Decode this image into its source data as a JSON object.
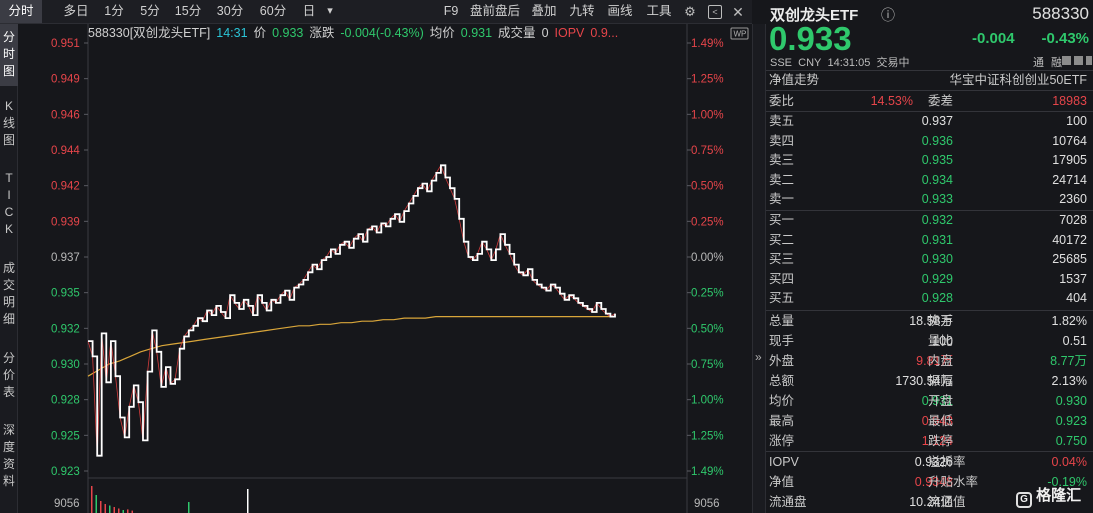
{
  "toolbar": {
    "tabs": [
      "分时",
      "多日",
      "1分",
      "5分",
      "15分",
      "30分",
      "60分",
      "日"
    ],
    "dropdown_glyph": "▾",
    "right_items": [
      "F9",
      "盘前盘后",
      "叠加",
      "九转",
      "画线",
      "工具"
    ]
  },
  "vtabs": [
    {
      "chars": [
        "分",
        "时",
        "图"
      ]
    },
    {
      "chars": [
        "K",
        "线",
        "图"
      ]
    },
    {
      "chars": [
        "T",
        "I",
        "C",
        "K"
      ]
    },
    {
      "chars": [
        "成",
        "交",
        "明",
        "细"
      ]
    },
    {
      "chars": [
        "分",
        "价",
        "表"
      ]
    },
    {
      "chars": [
        "深",
        "度",
        "资",
        "料"
      ]
    }
  ],
  "info_line": {
    "code_name": "588330[双创龙头ETF]",
    "time": "14:31",
    "price_label": "价",
    "price": "0.933",
    "change_label": "涨跌",
    "change": "-0.004(-0.43%)",
    "avg_label": "均价",
    "avg": "0.931",
    "vol_label": "成交量",
    "vol": "0",
    "iopv_label": "IOPV",
    "iopv": "0.9..."
  },
  "chart_data": {
    "type": "line",
    "left_axis": [
      {
        "label": "0.951",
        "color": "red"
      },
      {
        "label": "0.949",
        "color": "red"
      },
      {
        "label": "0.946",
        "color": "red"
      },
      {
        "label": "0.944",
        "color": "red"
      },
      {
        "label": "0.942",
        "color": "red"
      },
      {
        "label": "0.939",
        "color": "red"
      },
      {
        "label": "0.937",
        "color": "gray"
      },
      {
        "label": "0.935",
        "color": "green"
      },
      {
        "label": "0.932",
        "color": "green"
      },
      {
        "label": "0.930",
        "color": "green"
      },
      {
        "label": "0.928",
        "color": "green"
      },
      {
        "label": "0.925",
        "color": "green"
      },
      {
        "label": "0.923",
        "color": "green"
      }
    ],
    "right_axis": [
      {
        "label": "1.49%",
        "color": "red"
      },
      {
        "label": "1.25%",
        "color": "red"
      },
      {
        "label": "1.00%",
        "color": "red"
      },
      {
        "label": "0.75%",
        "color": "red"
      },
      {
        "label": "0.50%",
        "color": "red"
      },
      {
        "label": "0.25%",
        "color": "red"
      },
      {
        "label": "0.00%",
        "color": "gray"
      },
      {
        "label": "0.25%",
        "color": "green"
      },
      {
        "label": "0.50%",
        "color": "green"
      },
      {
        "label": "0.75%",
        "color": "green"
      },
      {
        "label": "1.00%",
        "color": "green"
      },
      {
        "label": "1.25%",
        "color": "green"
      },
      {
        "label": "1.49%",
        "color": "green"
      }
    ],
    "ylim": [
      0.923,
      0.951
    ],
    "volume_axis_label": "9056",
    "price_series": [
      0.9315,
      0.9305,
      0.924,
      0.932,
      0.9288,
      0.9315,
      0.9292,
      0.9265,
      0.9252,
      0.9272,
      0.9286,
      0.9275,
      0.925,
      0.9295,
      0.9322,
      0.9308,
      0.9285,
      0.9298,
      0.9287,
      0.929,
      0.931,
      0.9318,
      0.9322,
      0.9325,
      0.933,
      0.9328,
      0.9335,
      0.9332,
      0.9338,
      0.9334,
      0.933,
      0.9345,
      0.934,
      0.9336,
      0.9342,
      0.9338,
      0.9332,
      0.9345,
      0.934,
      0.9335,
      0.9342,
      0.934,
      0.9345,
      0.9348,
      0.9342,
      0.935,
      0.9352,
      0.9355,
      0.936,
      0.9365,
      0.9362,
      0.9368,
      0.937,
      0.9375,
      0.9372,
      0.9378,
      0.938,
      0.9376,
      0.9382,
      0.9385,
      0.938,
      0.9388,
      0.939,
      0.9386,
      0.9392,
      0.939,
      0.9395,
      0.9398,
      0.9393,
      0.94,
      0.9405,
      0.941,
      0.9415,
      0.9418,
      0.9413,
      0.942,
      0.9425,
      0.943,
      0.9422,
      0.9415,
      0.9408,
      0.9395,
      0.938,
      0.937,
      0.9368,
      0.9372,
      0.938,
      0.9375,
      0.9368,
      0.9375,
      0.9385,
      0.9378,
      0.9372,
      0.9365,
      0.936,
      0.9358,
      0.9362,
      0.9355,
      0.9352,
      0.935,
      0.9348,
      0.9352,
      0.935,
      0.9346,
      0.9342,
      0.9345,
      0.9343,
      0.934,
      0.9338,
      0.9336,
      0.9334,
      0.934,
      0.9336,
      0.9333,
      0.9331,
      0.9333
    ],
    "avg_series": [
      0.9292,
      0.9296,
      0.93,
      0.9302,
      0.9305,
      0.9308,
      0.931,
      0.9312,
      0.9313,
      0.9314,
      0.9315,
      0.9316,
      0.9317,
      0.9318,
      0.9319,
      0.932,
      0.9321,
      0.9322,
      0.9323,
      0.9324,
      0.9325,
      0.9325,
      0.9326,
      0.9326,
      0.9327,
      0.9327,
      0.9328,
      0.9328,
      0.9329,
      0.9329,
      0.933,
      0.933,
      0.933,
      0.9331,
      0.9331,
      0.9331,
      0.9331,
      0.9331,
      0.9331,
      0.9331,
      0.9331,
      0.9331,
      0.9331,
      0.9331,
      0.9331,
      0.9331,
      0.9331,
      0.9331,
      0.9331,
      0.9331,
      0.9331
    ],
    "volume_bars": [
      0.9,
      0.6,
      0.4,
      0.3,
      0.25,
      0.2,
      0.15,
      0.1,
      0.12,
      0.08
    ]
  },
  "quote": {
    "name": "双创龙头ETF",
    "info_icon": "ⓘ",
    "code": "588330",
    "price": "0.933",
    "change": "-0.004",
    "change_pct": "-0.43%",
    "meta": [
      "SSE",
      "CNY",
      "14:31:05",
      "交易中"
    ],
    "badges": [
      "通",
      "融"
    ],
    "nav_trend_label": "净值走势",
    "tracking_index": "华宝中证科创创业50ETF"
  },
  "orderbook": {
    "ratio_label": "委比",
    "ratio": "14.53%",
    "diff_label": "委差",
    "diff": "18983",
    "asks": [
      {
        "label": "卖五",
        "price": "0.937",
        "vol": "100",
        "color": "white"
      },
      {
        "label": "卖四",
        "price": "0.936",
        "vol": "10764",
        "color": "green"
      },
      {
        "label": "卖三",
        "price": "0.935",
        "vol": "17905",
        "color": "green"
      },
      {
        "label": "卖二",
        "price": "0.934",
        "vol": "24714",
        "color": "green"
      },
      {
        "label": "卖一",
        "price": "0.933",
        "vol": "2360",
        "color": "green"
      }
    ],
    "bids": [
      {
        "label": "买一",
        "price": "0.932",
        "vol": "7028",
        "color": "green"
      },
      {
        "label": "买二",
        "price": "0.931",
        "vol": "40172",
        "color": "green"
      },
      {
        "label": "买三",
        "price": "0.930",
        "vol": "25685",
        "color": "green"
      },
      {
        "label": "买四",
        "price": "0.929",
        "vol": "1537",
        "color": "green"
      },
      {
        "label": "买五",
        "price": "0.928",
        "vol": "404",
        "color": "green"
      }
    ]
  },
  "stats": [
    {
      "l1": "总量",
      "v1": "18.58万",
      "c1": "white",
      "l2": "换手",
      "v2": "1.82%",
      "c2": "white"
    },
    {
      "l1": "现手",
      "v1": "100",
      "c1": "white",
      "l2": "量比",
      "v2": "0.51",
      "c2": "white"
    },
    {
      "l1": "外盘",
      "v1": "9.81万",
      "c1": "red",
      "l2": "内盘",
      "v2": "8.77万",
      "c2": "green"
    },
    {
      "l1": "总额",
      "v1": "1730.54万",
      "c1": "white",
      "l2": "振幅",
      "v2": "2.13%",
      "c2": "white"
    },
    {
      "l1": "均价",
      "v1": "0.931",
      "c1": "green",
      "l2": "开盘",
      "v2": "0.930",
      "c2": "green"
    },
    {
      "l1": "最高",
      "v1": "0.943",
      "c1": "red",
      "l2": "最低",
      "v2": "0.923",
      "c2": "green"
    },
    {
      "l1": "涨停",
      "v1": "1.124",
      "c1": "red",
      "l2": "跌停",
      "v2": "0.750",
      "c2": "green"
    }
  ],
  "stats2": [
    {
      "l1": "IOPV",
      "v1": "0.9326",
      "c1": "white",
      "l2": "溢折率",
      "v2": "0.04%",
      "c2": "red"
    },
    {
      "l1": "净值",
      "v1": "0.9348",
      "c1": "red",
      "l2": "升贴水率",
      "v2": "-0.19%",
      "c2": "green"
    },
    {
      "l1": "流通盘",
      "v1": "10.24亿",
      "c1": "white",
      "l2": "流通值",
      "v2": "",
      "c2": "white"
    }
  ],
  "watermark": "格隆汇",
  "collapse_glyph": "»",
  "colors": {
    "red": "#e6454a",
    "green": "#2fc86c",
    "white": "#e0e0e0",
    "avg": "#d9a63a"
  }
}
